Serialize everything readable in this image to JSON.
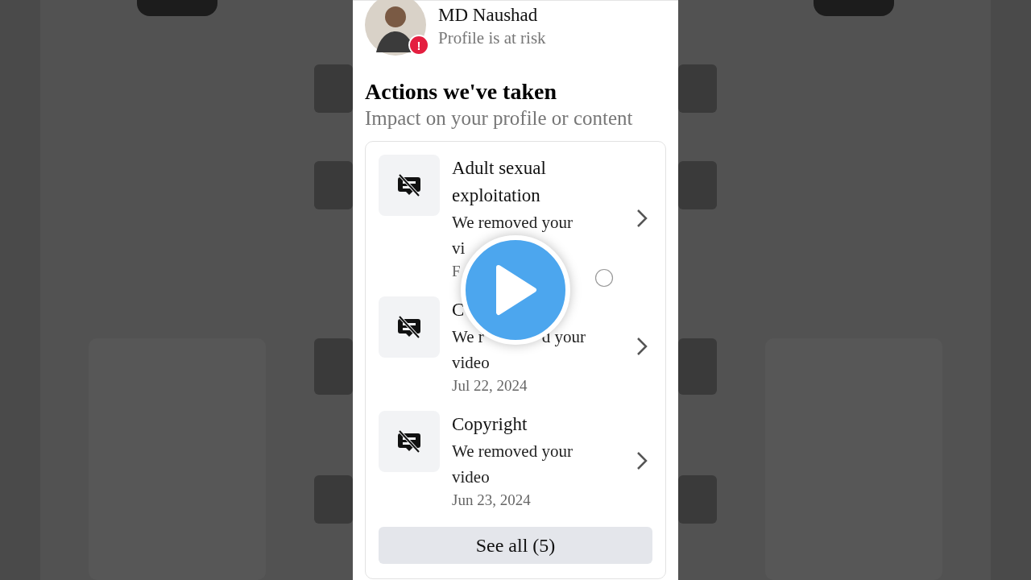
{
  "profile": {
    "name": "MD Naushad",
    "status": "Profile is at risk",
    "alert_badge": "!"
  },
  "section": {
    "title": "Actions we've taken",
    "subtitle": "Impact on your profile or content"
  },
  "actions": [
    {
      "title": "Adult sexual exploitation",
      "description_lines": [
        [
          "We removed your"
        ],
        [
          "vi"
        ]
      ],
      "date": "F"
    },
    {
      "title": "C",
      "description_lines": [
        [
          "We r",
          "d your"
        ],
        [
          "video"
        ]
      ],
      "date": "Jul 22, 2024"
    },
    {
      "title": "Copyright",
      "description_lines": [
        [
          "We removed your"
        ],
        [
          "video"
        ]
      ],
      "date": "Jun 23, 2024"
    }
  ],
  "see_all_button": "See all (5)"
}
